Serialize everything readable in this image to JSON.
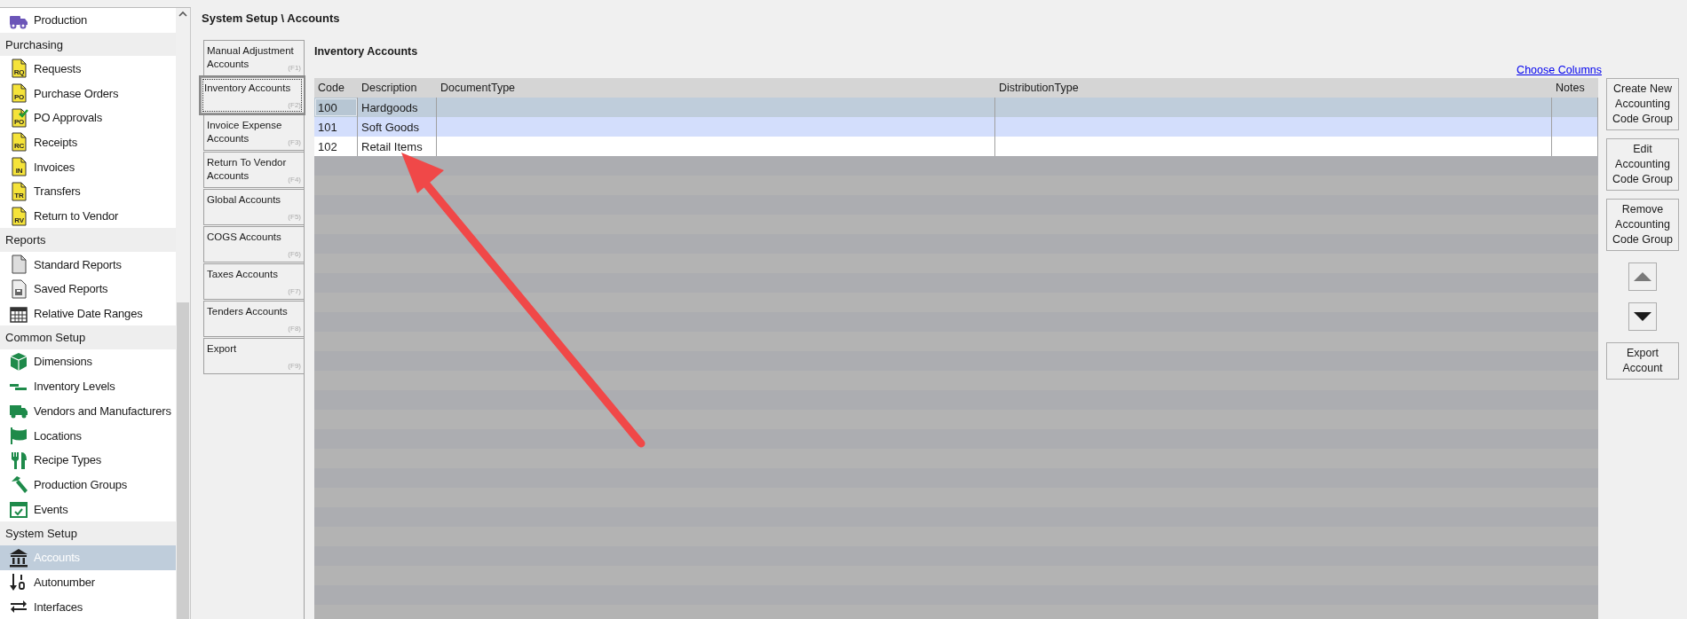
{
  "sidebar": {
    "groups": [
      {
        "items": [
          {
            "label": "Production",
            "selected": false
          }
        ]
      },
      {
        "title": "Purchasing",
        "items": [
          {
            "label": "Requests",
            "icon_text": "RQ",
            "selected": false
          },
          {
            "label": "Purchase Orders",
            "icon_text": "PO",
            "selected": false
          },
          {
            "label": "PO Approvals",
            "icon_text": "PO",
            "selected": false
          },
          {
            "label": "Receipts",
            "icon_text": "RC",
            "selected": false
          },
          {
            "label": "Invoices",
            "icon_text": "IN",
            "selected": false
          },
          {
            "label": "Transfers",
            "icon_text": "TR",
            "selected": false
          },
          {
            "label": "Return to Vendor",
            "icon_text": "RV",
            "selected": false
          }
        ]
      },
      {
        "title": "Reports",
        "items": [
          {
            "label": "Standard Reports",
            "selected": false
          },
          {
            "label": "Saved Reports",
            "selected": false
          },
          {
            "label": "Relative Date Ranges",
            "selected": false
          }
        ]
      },
      {
        "title": "Common Setup",
        "items": [
          {
            "label": "Dimensions",
            "selected": false
          },
          {
            "label": "Inventory Levels",
            "selected": false
          },
          {
            "label": "Vendors and Manufacturers",
            "selected": false
          },
          {
            "label": "Locations",
            "selected": false
          },
          {
            "label": "Recipe Types",
            "selected": false
          },
          {
            "label": "Production Groups",
            "selected": false
          },
          {
            "label": "Events",
            "selected": false
          }
        ]
      },
      {
        "title": "System Setup",
        "items": [
          {
            "label": "Accounts",
            "selected": true
          },
          {
            "label": "Autonumber",
            "selected": false
          },
          {
            "label": "Interfaces",
            "selected": false
          }
        ]
      }
    ]
  },
  "breadcrumb": "System Setup \\ Accounts",
  "tabs": [
    {
      "label": "Manual Adjustment Accounts",
      "key": "(F1)",
      "selected": false
    },
    {
      "label": "Inventory Accounts",
      "key": "(F2)",
      "selected": true
    },
    {
      "label": "Invoice Expense Accounts",
      "key": "(F3)",
      "selected": false
    },
    {
      "label": "Return To Vendor Accounts",
      "key": "(F4)",
      "selected": false
    },
    {
      "label": "Global Accounts",
      "key": "(F5)",
      "selected": false
    },
    {
      "label": "COGS Accounts",
      "key": "(F6)",
      "selected": false
    },
    {
      "label": "Taxes Accounts",
      "key": "(F7)",
      "selected": false
    },
    {
      "label": "Tenders Accounts",
      "key": "(F8)",
      "selected": false
    },
    {
      "label": "Export",
      "key": "(F9)",
      "selected": false
    }
  ],
  "panel_title": "Inventory Accounts",
  "choose_columns": "Choose Columns",
  "table": {
    "columns": [
      "Code",
      "Description",
      "DocumentType",
      "DistributionType",
      "Notes"
    ],
    "rows": [
      {
        "cells": [
          "100",
          "Hardgoods",
          "",
          "",
          ""
        ],
        "selected": true,
        "hovered": false
      },
      {
        "cells": [
          "101",
          "Soft Goods",
          "",
          "",
          ""
        ],
        "selected": false,
        "hovered": true
      },
      {
        "cells": [
          "102",
          "Retail Items",
          "",
          "",
          ""
        ],
        "selected": false,
        "hovered": false
      }
    ]
  },
  "actions": [
    {
      "kind": "text",
      "label": "Create New Accounting Code Group"
    },
    {
      "kind": "text",
      "label": "Edit Accounting Code Group"
    },
    {
      "kind": "text",
      "label": "Remove Accounting Code Group"
    },
    {
      "kind": "up",
      "disabled": true
    },
    {
      "kind": "down",
      "disabled": false
    },
    {
      "kind": "text",
      "label": "Export Account"
    }
  ]
}
